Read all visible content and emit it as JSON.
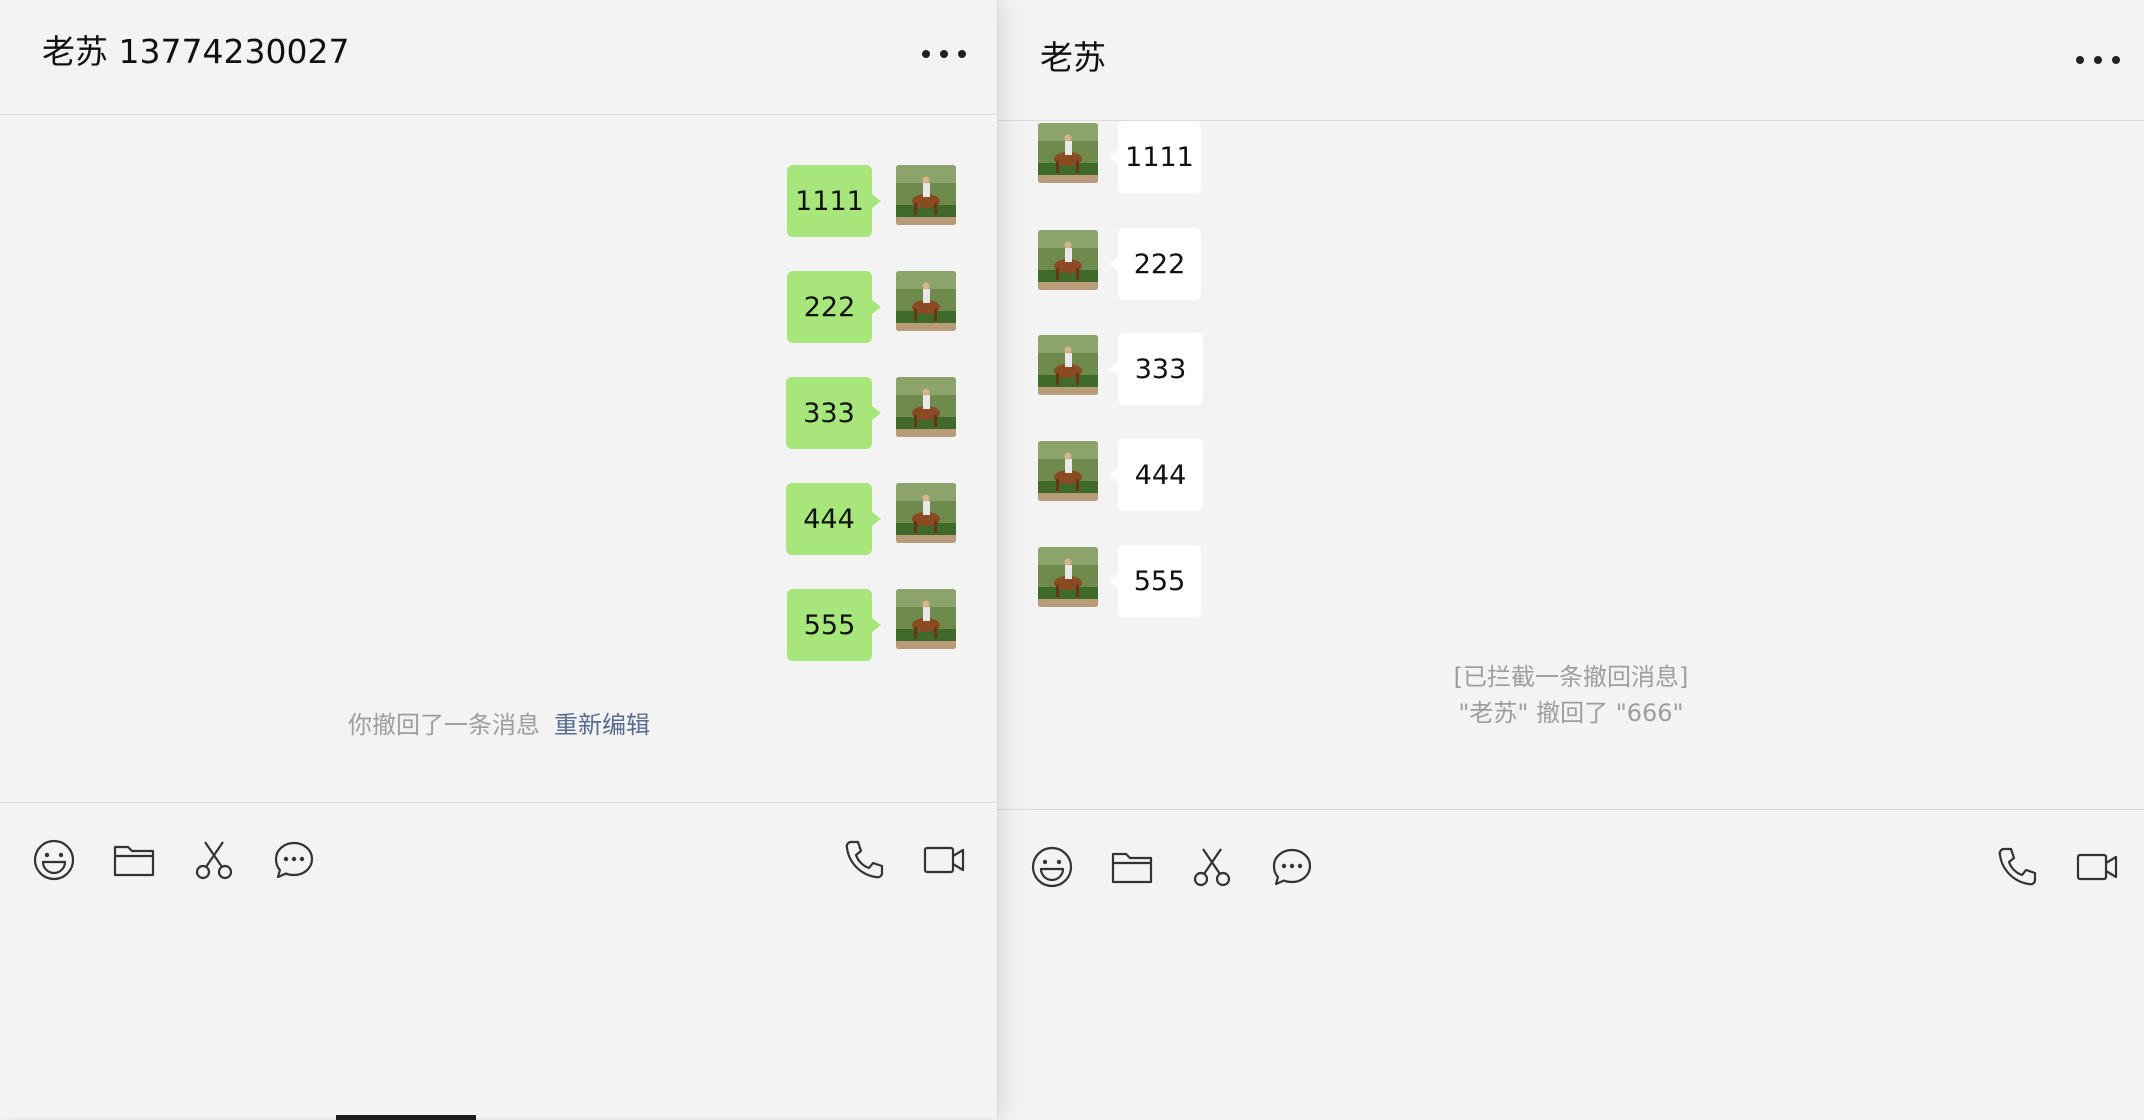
{
  "left_window": {
    "title": "老苏 13774230027",
    "messages": [
      {
        "text": "1111"
      },
      {
        "text": "222"
      },
      {
        "text": "333"
      },
      {
        "text": "444"
      },
      {
        "text": "555"
      }
    ],
    "recall_notice": "你撤回了一条消息",
    "reedit_link": "重新编辑",
    "toolbar_icons": [
      "emoji-icon",
      "folder-icon",
      "scissors-icon",
      "chat-history-icon",
      "phone-icon",
      "video-icon"
    ]
  },
  "right_window": {
    "title": "老苏",
    "messages": [
      {
        "text": "1111"
      },
      {
        "text": "222"
      },
      {
        "text": "333"
      },
      {
        "text": "444"
      },
      {
        "text": "555"
      }
    ],
    "intercept_notice_line1": "[已拦截一条撤回消息]",
    "intercept_notice_line2": "\"老苏\" 撤回了 \"666\"",
    "toolbar_icons": [
      "emoji-icon",
      "folder-icon",
      "scissors-icon",
      "chat-history-icon",
      "phone-icon",
      "video-icon"
    ]
  },
  "colors": {
    "background": "#f3f3f3",
    "sent_bubble": "#a6e67a",
    "received_bubble": "#ffffff",
    "notice_text": "#9e9e9e",
    "link_text": "#5a6d91"
  }
}
